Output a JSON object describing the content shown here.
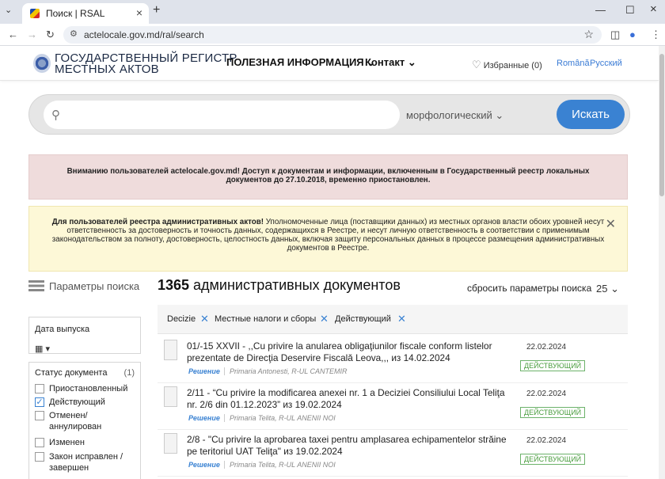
{
  "browser": {
    "tab_title": "Поиск | RSAL",
    "url": "actelocale.gov.md/ral/search"
  },
  "header": {
    "logo_line1": "ГОСУДАРСТВЕННЫЙ РЕГИСТР",
    "logo_line2": "МЕСТНЫХ АКТОВ",
    "menu_useful": "ПОЛЕЗНАЯ ИНФОРМАЦИЯ",
    "menu_contact": "Контакт",
    "favorites": "Избранные (0)",
    "lang_ro": "Română",
    "lang_ru": "Русский"
  },
  "search": {
    "mode": "морфологический",
    "button": "Искать"
  },
  "alerts": {
    "red": "Вниманию пользователей actelocale.gov.md! Доступ к документам и информации, включенным в Государственный реестр локальных документов до 27.10.2018, временно приостановлен.",
    "yellow_bold": "Для пользователей реестра административных актов!",
    "yellow_text": " Уполномоченные лица (поставщики данных) из местных органов власти обоих уровней несут ответственность за достоверность и точность данных, содержащихся в Реестре, и несут личную ответственность в соответствии с применимым законодательством за полноту, достоверность, целостность данных, включая защиту персональных данных в процессе размещения административных документов в Реестре."
  },
  "sidebar": {
    "params_title": "Параметры поиска",
    "date_label": "Дата выпуска",
    "status_label": "Статус документа",
    "status_count": "(1)",
    "statuses": [
      {
        "label": "Приостановленный",
        "checked": false
      },
      {
        "label": "Действующий",
        "checked": true
      },
      {
        "label": "Отменен/ аннулирован",
        "checked": false
      },
      {
        "label": "Изменен",
        "checked": false
      },
      {
        "label": "Закон исправлен / завершен",
        "checked": false
      }
    ]
  },
  "results": {
    "count": "1365",
    "count_label": " административных документов",
    "reset": "сбросить параметры поиска",
    "per_page": "25",
    "filters": [
      "Decizie",
      "Местные налоги и сборы",
      "Действующий"
    ],
    "docs": [
      {
        "title": "01/-15 XXVII - ,,Cu privire la anularea obligaţiunilor fiscale conform listelor prezentate de Direcţia Deservire Fiscală Leova,,, из 14.02.2024",
        "type": "Решение",
        "org": "Primaria Antonesti, R-UL CANTEMIR",
        "date": "22.02.2024",
        "status": "ДЕЙСТВУЮЩИЙ"
      },
      {
        "title": "2/11 - “Cu privire la modificarea anexei nr. 1 a Deciziei Consiliului Local Teliţa nr. 2/6 din 01.12.2023” из 19.02.2024",
        "type": "Решение",
        "org": "Primaria Telita, R-UL ANENII NOI",
        "date": "22.02.2024",
        "status": "ДЕЙСТВУЮЩИЙ"
      },
      {
        "title": "2/8 - \"Cu privire la aprobarea taxei pentru amplasarea echipamentelor străine pe teritoriul UAT Teliţa\" из 19.02.2024",
        "type": "Решение",
        "org": "Primaria Telita, R-UL ANENII NOI",
        "date": "22.02.2024",
        "status": "ДЕЙСТВУЮЩИЙ"
      }
    ]
  }
}
